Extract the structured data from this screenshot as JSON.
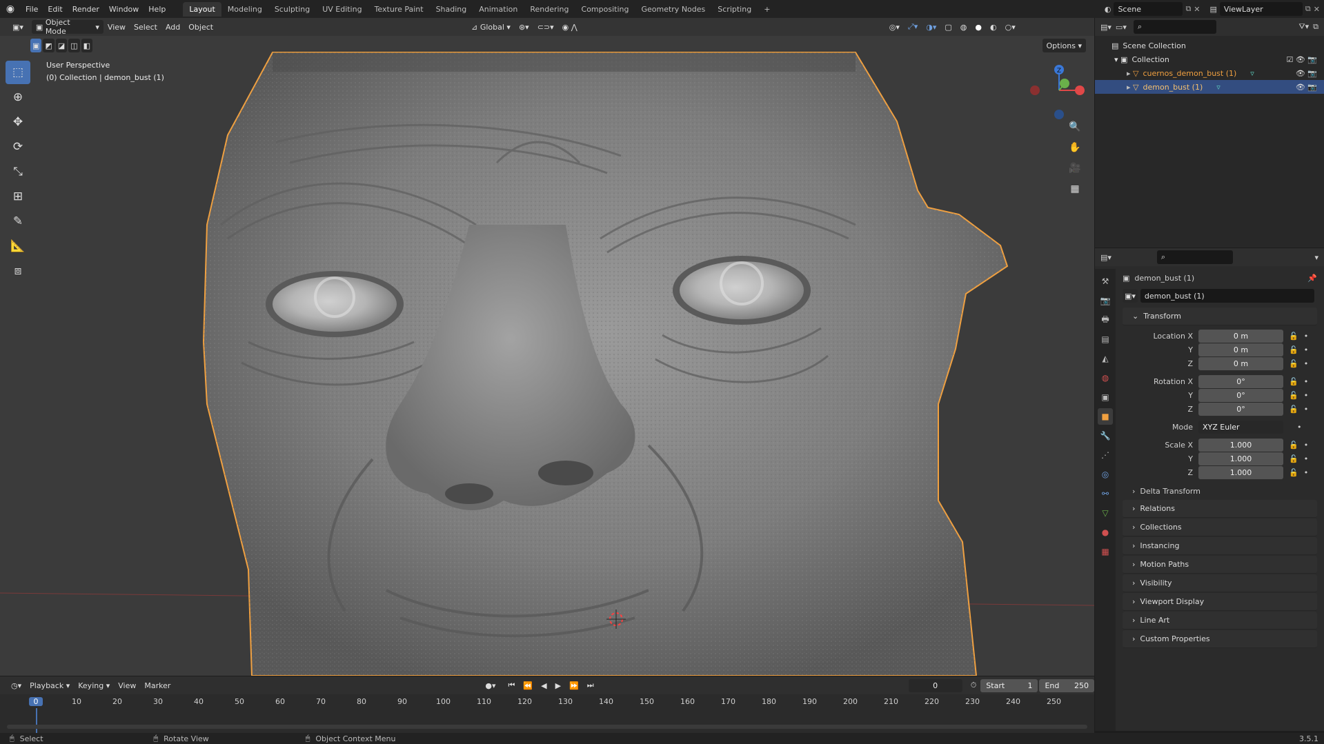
{
  "menus": [
    "File",
    "Edit",
    "Render",
    "Window",
    "Help"
  ],
  "workspaces": [
    "Layout",
    "Modeling",
    "Sculpting",
    "UV Editing",
    "Texture Paint",
    "Shading",
    "Animation",
    "Rendering",
    "Compositing",
    "Geometry Nodes",
    "Scripting"
  ],
  "active_workspace": "Layout",
  "scene_name": "Scene",
  "view_layer": "ViewLayer",
  "viewport": {
    "mode": "Object Mode",
    "menus": [
      "View",
      "Select",
      "Add",
      "Object"
    ],
    "orientation": "Global",
    "options": "Options",
    "overlay_line1": "User Perspective",
    "overlay_line2": "(0) Collection | demon_bust (1)"
  },
  "outliner": {
    "scene_collection": "Scene Collection",
    "collection": "Collection",
    "items": [
      "cuernos_demon_bust (1)",
      "demon_bust (1)"
    ]
  },
  "properties": {
    "object_name": "demon_bust (1)",
    "datablock": "demon_bust (1)",
    "transform": "Transform",
    "location_label": "Location X",
    "rotation_label": "Rotation X",
    "scale_label": "Scale X",
    "y": "Y",
    "z": "Z",
    "loc": [
      "0 m",
      "0 m",
      "0 m"
    ],
    "rot": [
      "0°",
      "0°",
      "0°"
    ],
    "mode_label": "Mode",
    "mode_value": "XYZ Euler",
    "scale": [
      "1.000",
      "1.000",
      "1.000"
    ],
    "delta": "Delta Transform",
    "panels": [
      "Relations",
      "Collections",
      "Instancing",
      "Motion Paths",
      "Visibility",
      "Viewport Display",
      "Line Art",
      "Custom Properties"
    ]
  },
  "timeline": {
    "menus": [
      "Playback",
      "Keying",
      "View",
      "Marker"
    ],
    "current_frame": "0",
    "start_label": "Start",
    "start": "1",
    "end_label": "End",
    "end": "250",
    "ticks": [
      "0",
      "10",
      "20",
      "30",
      "40",
      "50",
      "60",
      "70",
      "80",
      "90",
      "100",
      "110",
      "120",
      "130",
      "140",
      "150",
      "160",
      "170",
      "180",
      "190",
      "200",
      "210",
      "220",
      "230",
      "240",
      "250"
    ]
  },
  "status": {
    "select": "Select",
    "rotate": "Rotate View",
    "context": "Object Context Menu",
    "version": "3.5.1"
  },
  "colors": {
    "accent": "#4772b3",
    "selection": "#f0a040",
    "header": "#232323"
  }
}
